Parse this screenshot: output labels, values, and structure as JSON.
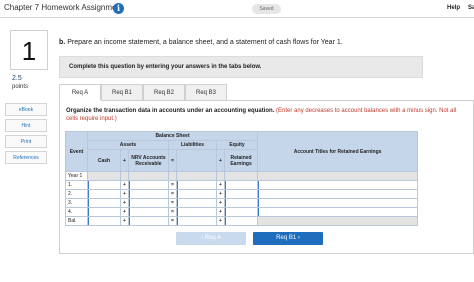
{
  "topbar": {
    "title": "Chapter 7 Homework Assignment",
    "info_glyph": "i",
    "status": "Saved",
    "help": "Help",
    "save": "Sa"
  },
  "question": {
    "number": "1",
    "points_value": "2.5",
    "points_label": "points"
  },
  "side_links": [
    "eBook",
    "Hint",
    "Print",
    "References"
  ],
  "prompt": {
    "label": "b.",
    "text": "Prepare an income statement, a balance sheet, and a statement of cash flows for Year 1."
  },
  "instruction": "Complete this question by entering your answers in the tabs below.",
  "tabs": [
    "Req A",
    "Req B1",
    "Req B2",
    "Req B3"
  ],
  "org_text": "Organize the transaction data in accounts under an accounting equation.",
  "org_note": "(Enter any decreases to account balances with a minus sign. Not all cells require input.)",
  "table": {
    "balance_sheet": "Balance Sheet",
    "assets": "Assets",
    "liabilities": "Liabilities",
    "equity": "Equity",
    "event": "Event",
    "cash": "Cash",
    "nrv": "NRV Accounts Receivable",
    "retained": "Retained Earnings",
    "titles": "Account Titles for Retained Earnings",
    "eq_sign": "=",
    "plus_sign": "+",
    "rows": [
      "Year 1",
      "1.",
      "2.",
      "3.",
      "4.",
      "Bal."
    ]
  },
  "nav": {
    "prev": "‹  Req A",
    "next": "Req B1  ›"
  }
}
